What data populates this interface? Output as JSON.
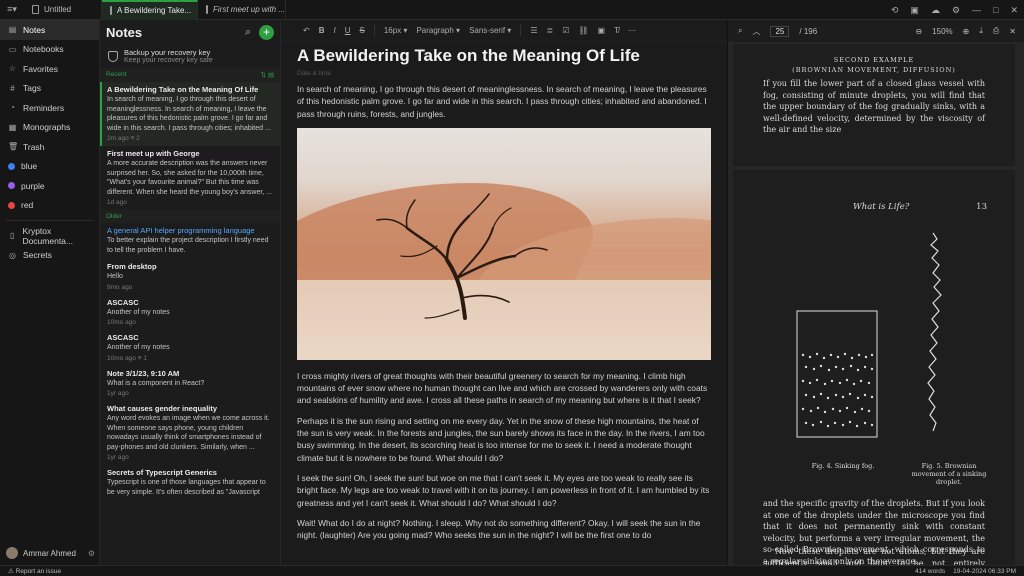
{
  "tabs": [
    {
      "label": "Untitled"
    },
    {
      "label": "A Bewildering Take...",
      "active": true
    },
    {
      "label": "First meet up with ..."
    }
  ],
  "nav": {
    "items": [
      {
        "label": "Notes",
        "icon": "notes-icon"
      },
      {
        "label": "Notebooks",
        "icon": "notebook-icon"
      },
      {
        "label": "Favorites",
        "icon": "star-icon"
      },
      {
        "label": "Tags",
        "icon": "tag-icon"
      },
      {
        "label": "Reminders",
        "icon": "bell-icon"
      },
      {
        "label": "Monographs",
        "icon": "monograph-icon"
      },
      {
        "label": "Trash",
        "icon": "trash-icon"
      }
    ],
    "colors": [
      {
        "label": "blue",
        "color": "#3b82f6"
      },
      {
        "label": "purple",
        "color": "#9b5de5"
      },
      {
        "label": "red",
        "color": "#ef4444"
      }
    ],
    "extra": [
      {
        "label": "Kryptox Documenta...",
        "icon": "book-icon"
      },
      {
        "label": "Secrets",
        "icon": "globe-icon"
      }
    ],
    "user": "Ammar Ahmed"
  },
  "list": {
    "title": "Notes",
    "backup_title": "Backup your recovery key",
    "backup_sub": "Keep your recovery key safe",
    "recent_label": "Recent",
    "older_label": "Older",
    "recent": [
      {
        "title": "A Bewildering Take on the Meaning Of Life",
        "body": "In search of meaning, I go through this desert of meaninglessness. In search of meaning, I leave the pleasures of this hedonistic palm grove. I go far and wide in this search. I pass through cities; inhabited ...",
        "meta": "2m ago  ≡ 2"
      },
      {
        "title": "First meet up with George",
        "body": "A more accurate description was the answers never surprised her. So, she asked for the 10,000th time, \"What's your favourite animal?\" But this time was different. When she heard the young boy's answer, ...",
        "meta": "1d ago"
      }
    ],
    "older": [
      {
        "title": "A general API helper programming language",
        "body": "To better explain the project description I firstly need to tell the problem I have.",
        "meta": "",
        "link": true
      },
      {
        "title": "From desktop",
        "body": "Hello",
        "meta": "9mo ago"
      },
      {
        "title": "ASCASC",
        "body": "Another of my notes",
        "meta": "10mo ago"
      },
      {
        "title": "ASCASC",
        "body": "Another of my notes",
        "meta": "10mo ago  ≡ 1"
      },
      {
        "title": "Note 3/1/23, 9:10 AM",
        "body": "What is a component in React?",
        "meta": "1yr ago"
      },
      {
        "title": "What causes gender inequality",
        "body": "Any word evokes an image when we come across it. When someone says phone, young children nowadays usually think of smartphones instead of pay-phones and old clunkers. Similarly, when ...",
        "meta": "1yr ago"
      },
      {
        "title": "Secrets of Typescript Generics",
        "body": "Typescript is one of those languages that appear to be very simple. It's often described as \"Javascript",
        "meta": ""
      }
    ]
  },
  "toolbar": {
    "font_size": "16px",
    "block": "Paragraph",
    "font": "Sans-serif"
  },
  "doc": {
    "title": "A Bewildering Take on the Meaning Of Life",
    "date": "Date & time",
    "p1": "In search of meaning, I go through this desert of meaninglessness. In search of meaning, I leave the pleasures of this hedonistic palm grove. I go far and wide in this search. I pass through cities; inhabited and abandoned. I pass through ruins, forests, and jungles.",
    "p2": "I cross mighty rivers of great thoughts with their beautiful greenery to search for my meaning. I climb high mountains of ever snow where no human thought can live and which are crossed by wanderers only with coats and sealskins of humility and awe. I cross all these paths in search of my meaning but where is it that I seek?",
    "p3": "Perhaps it is the sun rising and setting on me every day. Yet in the snow of these high mountains, the heat of the sun is very weak. In the forests and jungles, the sun barely shows its face in the day. In the rivers, I am too busy swimming. In the desert, its scorching heat is too intense for me to seek it. I need a moderate thought climate but it is nowhere to be found. What should I do?",
    "p4": "I seek the sun! Oh, I seek the sun! but woe on me that I can't seek it. My eyes are too weak to really see its bright face. My legs are too weak to travel with it on its journey. I am powerless in front of it. I am humbled by its greatness and yet I can't seek it. What should I do? What should I do?",
    "p5": "Wait! What do I do at night? Nothing. I sleep. Why not do something different? Okay. I will seek the sun in the night. (laughter) Are you going mad? Who seeks the sun in the night? I will be the first one to do"
  },
  "pdf": {
    "page": "25",
    "total": "/ 196",
    "zoom": "150%",
    "p1_title": "SECOND EXAMPLE",
    "p1_sub": "(BROWNIAN MOVEMENT, DIFFUSION)",
    "p1_text": "If you fill the lower part of a closed glass vessel with fog, consisting of minute droplets, you will find that the upper boundary of the fog gradually sinks, with a well-defined velocity, determined by the viscosity of the air and the size",
    "p2_header": "What is Life?",
    "p2_num": "13",
    "fig4": "Fig. 4. Sinking fog.",
    "fig5": "Fig. 5. Brownian movement of a sinking droplet.",
    "p2_text": "and the specific gravity of the droplets. But if you look at one of the droplets under the microscope you find that it does not permanently sink with constant velocity, but performs a very irregular movement, the so-called Brownian movement, which corresponds to a regular sinking only on the average.",
    "p2_text2": "Now these droplets are not atoms, but they are sufficiently small and light to be not entirely insusceptible to the impact of one single molecule of those which hammer their surface in"
  },
  "status": {
    "left": "Report an issue",
    "words": "414 words",
    "date": "19-04-2024 06:33 PM"
  }
}
